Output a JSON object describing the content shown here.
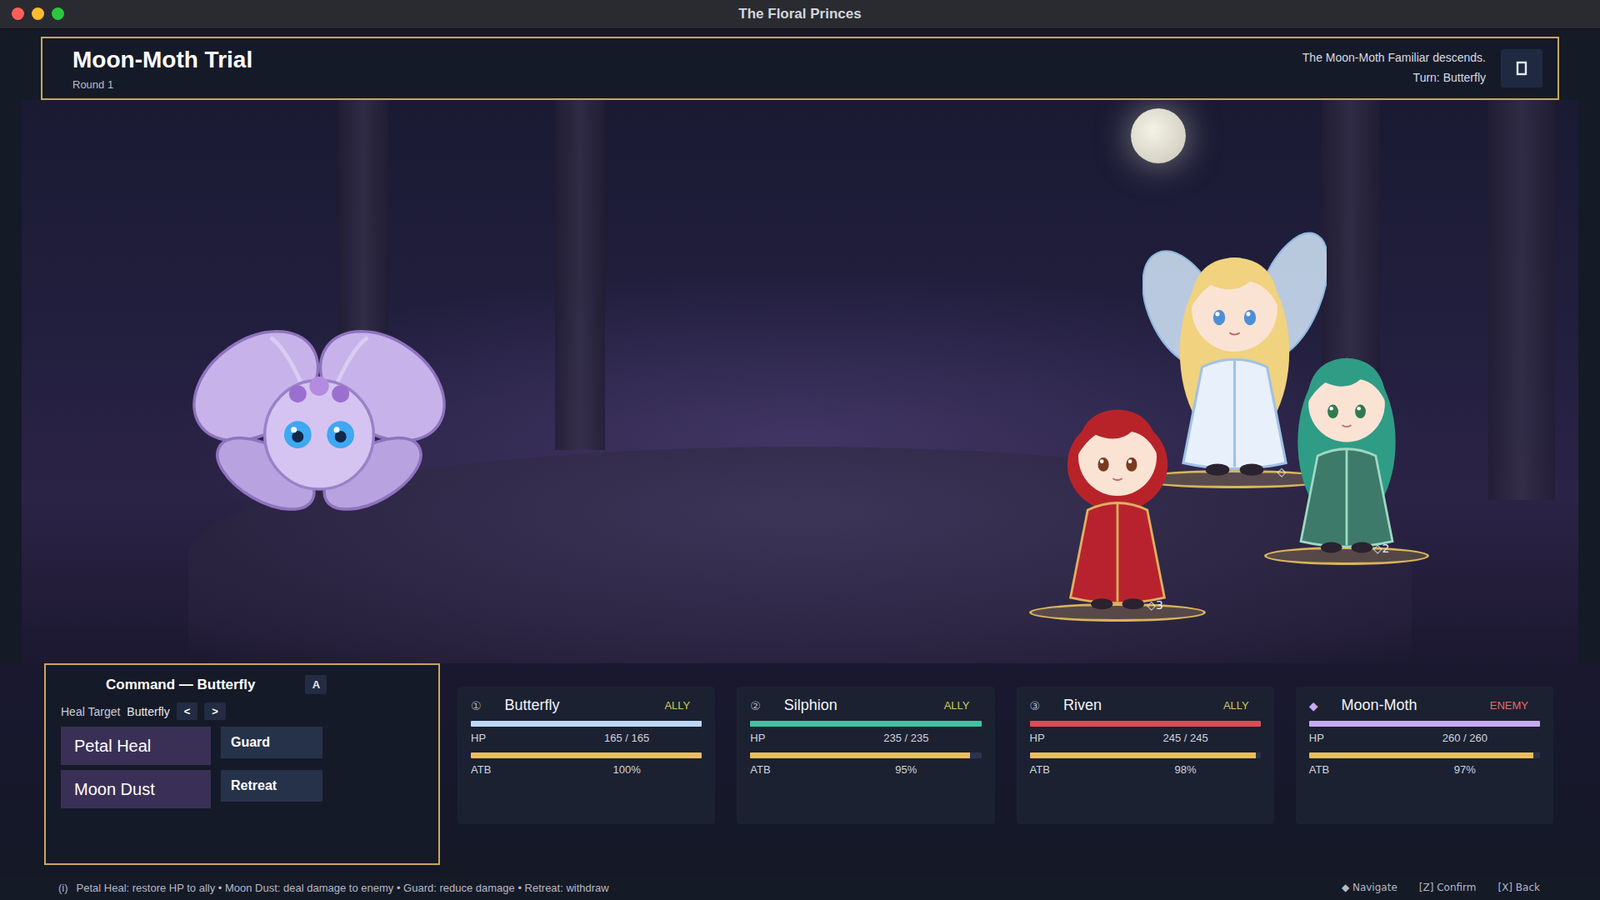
{
  "window": {
    "title": "The Floral Princes"
  },
  "banner": {
    "title": "Moon-Moth Trial",
    "round": "Round 1",
    "log": "The Moon-Moth Familiar descends.",
    "turn": "Turn: Butterfly"
  },
  "scene": {
    "figures": [
      {
        "name": "Moon-Moth",
        "kind": "moth",
        "marker": ""
      },
      {
        "name": "Butterfly",
        "kind": "fairy",
        "marker": "◇"
      },
      {
        "name": "Riven",
        "kind": "swordsman",
        "marker": "◇3"
      },
      {
        "name": "Silphion",
        "kind": "sage",
        "marker": "◇2"
      }
    ]
  },
  "command": {
    "title": "Command — Butterfly",
    "hotkey": "A",
    "heal_target_label": "Heal Target",
    "heal_target": "Butterfly",
    "prev": "<",
    "next": ">",
    "actions": [
      {
        "label": "Petal Heal",
        "kind": "primary"
      },
      {
        "label": "Guard",
        "kind": "secondary"
      },
      {
        "label": "Moon Dust",
        "kind": "primary"
      },
      {
        "label": "Retreat",
        "kind": "secondary"
      }
    ]
  },
  "units": [
    {
      "slot": "①",
      "name": "Butterfly",
      "side": "ALLY",
      "enemy": false,
      "hp_label": "HP",
      "hp": "165 / 165",
      "hp_level": 1,
      "color": "#bcd8f8",
      "atb_label": "ATB",
      "atb": "100%",
      "atb_level": 1
    },
    {
      "slot": "②",
      "name": "Silphion",
      "side": "ALLY",
      "enemy": false,
      "hp_label": "HP",
      "hp": "235 / 235",
      "hp_level": 1,
      "color": "#3fc4a2",
      "atb_label": "ATB",
      "atb": "95%",
      "atb_level": 0.95
    },
    {
      "slot": "③",
      "name": "Riven",
      "side": "ALLY",
      "enemy": false,
      "hp_label": "HP",
      "hp": "245 / 245",
      "hp_level": 1,
      "color": "#e04a58",
      "atb_label": "ATB",
      "atb": "98%",
      "atb_level": 0.98
    },
    {
      "slot": "◆",
      "name": "Moon-Moth",
      "side": "ENEMY",
      "enemy": true,
      "hp_label": "HP",
      "hp": "260 / 260",
      "hp_level": 1,
      "color": "#c9a9f2",
      "atb_label": "ATB",
      "atb": "97%",
      "atb_level": 0.97
    }
  ],
  "footer": {
    "info_icon": "(i)",
    "hint": "Petal Heal: restore HP to ally • Moon Dust: deal damage to enemy • Guard: reduce damage • Retreat: withdraw",
    "keys": [
      "◆ Navigate",
      "[Z] Confirm",
      "[X] Back"
    ]
  }
}
